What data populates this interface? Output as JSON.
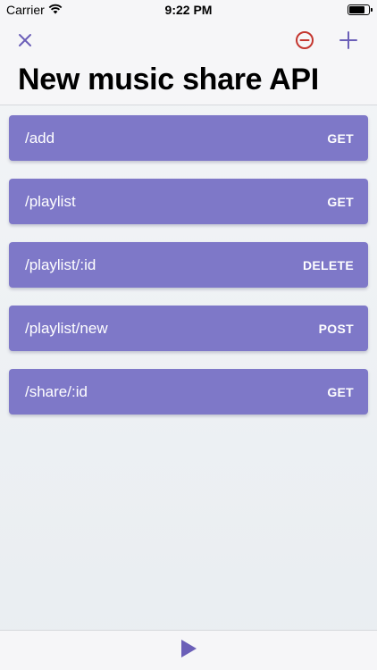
{
  "status_bar": {
    "carrier": "Carrier",
    "time": "9:22 PM",
    "battery_level": 0.8
  },
  "nav": {
    "title": "New music share API",
    "close_icon": "close-icon",
    "remove_icon": "minus-circle-icon",
    "add_icon": "plus-icon"
  },
  "routes": [
    {
      "path": "/add",
      "method": "GET"
    },
    {
      "path": "/playlist",
      "method": "GET"
    },
    {
      "path": "/playlist/:id",
      "method": "DELETE"
    },
    {
      "path": "/playlist/new",
      "method": "POST"
    },
    {
      "path": "/share/:id",
      "method": "GET"
    }
  ],
  "toolbar": {
    "play_icon": "play-icon"
  },
  "colors": {
    "accent": "#6b5fb8",
    "row_background": "#7e78c8",
    "remove": "#c4362f"
  }
}
